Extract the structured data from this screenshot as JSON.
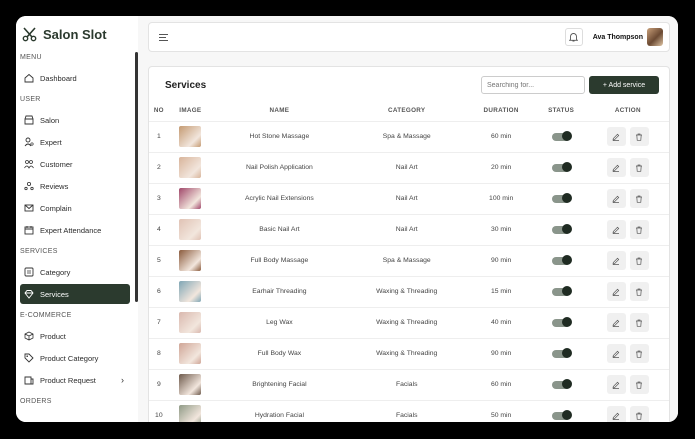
{
  "app": {
    "name": "Salon Slot"
  },
  "sidebar": {
    "sections": [
      {
        "title": "MENU",
        "items": [
          {
            "label": "Dashboard",
            "icon": "home-icon"
          }
        ]
      },
      {
        "title": "USER",
        "items": [
          {
            "label": "Salon",
            "icon": "store-icon"
          },
          {
            "label": "Expert",
            "icon": "user-gear-icon"
          },
          {
            "label": "Customer",
            "icon": "users-icon"
          },
          {
            "label": "Reviews",
            "icon": "reviews-icon"
          },
          {
            "label": "Complain",
            "icon": "mail-icon"
          },
          {
            "label": "Expert Attendance",
            "icon": "calendar-icon"
          }
        ]
      },
      {
        "title": "SERVICES",
        "items": [
          {
            "label": "Category",
            "icon": "category-icon"
          },
          {
            "label": "Services",
            "icon": "diamond-icon",
            "active": true
          }
        ]
      },
      {
        "title": "E-COMMERCE",
        "items": [
          {
            "label": "Product",
            "icon": "box-icon"
          },
          {
            "label": "Product Category",
            "icon": "tag-icon"
          },
          {
            "label": "Product Request",
            "icon": "request-icon",
            "chevron": true
          }
        ]
      },
      {
        "title": "ORDERS",
        "items": []
      }
    ]
  },
  "header": {
    "user_name": "Ava Thompson"
  },
  "services": {
    "title": "Services",
    "search_placeholder": "Searching for...",
    "add_label": "+ Add service",
    "columns": [
      "NO",
      "IMAGE",
      "NAME",
      "CATEGORY",
      "DURATION",
      "STATUS",
      "ACTION"
    ],
    "rows": [
      {
        "no": "1",
        "name": "Hot Stone Massage",
        "category": "Spa & Massage",
        "duration": "60 min",
        "thumb": "#c49a72"
      },
      {
        "no": "2",
        "name": "Nail Polish Application",
        "category": "Nail Art",
        "duration": "20 min",
        "thumb": "#d8b49a"
      },
      {
        "no": "3",
        "name": "Acrylic Nail Extensions",
        "category": "Nail Art",
        "duration": "100 min",
        "thumb": "#a0476a"
      },
      {
        "no": "4",
        "name": "Basic Nail Art",
        "category": "Nail Art",
        "duration": "30 min",
        "thumb": "#e0c2b4"
      },
      {
        "no": "5",
        "name": "Full Body Massage",
        "category": "Spa & Massage",
        "duration": "90 min",
        "thumb": "#8a5a3c"
      },
      {
        "no": "6",
        "name": "Earhair Threading",
        "category": "Waxing & Threading",
        "duration": "15 min",
        "thumb": "#7fa6b5"
      },
      {
        "no": "7",
        "name": "Leg Wax",
        "category": "Waxing & Threading",
        "duration": "40 min",
        "thumb": "#d9b8ae"
      },
      {
        "no": "8",
        "name": "Full Body Wax",
        "category": "Waxing & Threading",
        "duration": "90 min",
        "thumb": "#cfa596"
      },
      {
        "no": "9",
        "name": "Brightening Facial",
        "category": "Facials",
        "duration": "60 min",
        "thumb": "#6e5a4c"
      },
      {
        "no": "10",
        "name": "Hydration Facial",
        "category": "Facials",
        "duration": "50 min",
        "thumb": "#8f9a86"
      }
    ]
  },
  "colors": {
    "brand": "#2b3a2e",
    "toggle_on": "#1f2b22"
  }
}
